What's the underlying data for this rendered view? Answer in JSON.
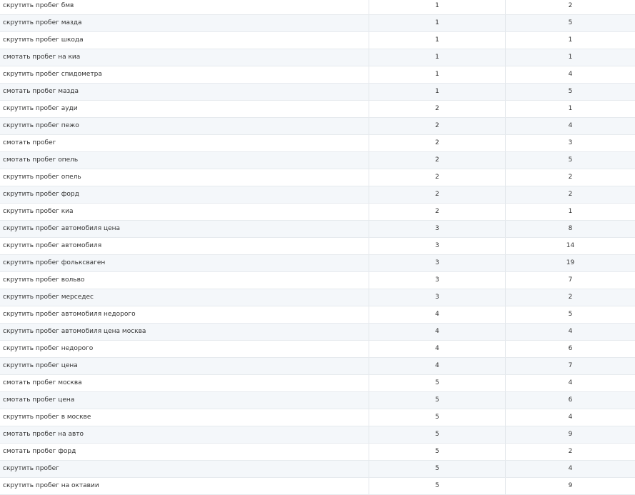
{
  "table": {
    "rows": [
      {
        "query": "скрутить пробег бмв",
        "a": "1",
        "b": "2"
      },
      {
        "query": "скрутить пробег мазда",
        "a": "1",
        "b": "5"
      },
      {
        "query": "скрутить пробег шкода",
        "a": "1",
        "b": "1"
      },
      {
        "query": "смотать пробег на киа",
        "a": "1",
        "b": "1"
      },
      {
        "query": "скрутить пробег спидометра",
        "a": "1",
        "b": "4"
      },
      {
        "query": "смотать пробег мазда",
        "a": "1",
        "b": "5"
      },
      {
        "query": "скрутить пробег ауди",
        "a": "2",
        "b": "1"
      },
      {
        "query": "скрутить пробег пежо",
        "a": "2",
        "b": "4"
      },
      {
        "query": "смотать пробег",
        "a": "2",
        "b": "3"
      },
      {
        "query": "смотать пробег опель",
        "a": "2",
        "b": "5"
      },
      {
        "query": "скрутить пробег опель",
        "a": "2",
        "b": "2"
      },
      {
        "query": "скрутить пробег форд",
        "a": "2",
        "b": "2"
      },
      {
        "query": "скрутить пробег киа",
        "a": "2",
        "b": "1"
      },
      {
        "query": "скрутить пробег автомобиля цена",
        "a": "3",
        "b": "8"
      },
      {
        "query": "скрутить пробег автомобиля",
        "a": "3",
        "b": "14"
      },
      {
        "query": "скрутить пробег фольксваген",
        "a": "3",
        "b": "19"
      },
      {
        "query": "скрутить пробег вольво",
        "a": "3",
        "b": "7"
      },
      {
        "query": "скрутить пробег мерседес",
        "a": "3",
        "b": "2"
      },
      {
        "query": "скрутить пробег автомобиля недорого",
        "a": "4",
        "b": "5"
      },
      {
        "query": "скрутить пробег автомобиля цена москва",
        "a": "4",
        "b": "4"
      },
      {
        "query": "скрутить пробег недорого",
        "a": "4",
        "b": "6"
      },
      {
        "query": "скрутить пробег цена",
        "a": "4",
        "b": "7"
      },
      {
        "query": "смотать пробег москва",
        "a": "5",
        "b": "4"
      },
      {
        "query": "смотать пробег цена",
        "a": "5",
        "b": "6"
      },
      {
        "query": "скрутить пробег в москве",
        "a": "5",
        "b": "4"
      },
      {
        "query": "смотать пробег на авто",
        "a": "5",
        "b": "9"
      },
      {
        "query": "смотать пробег форд",
        "a": "5",
        "b": "2"
      },
      {
        "query": "скрутить пробег",
        "a": "5",
        "b": "4"
      },
      {
        "query": "скрутить пробег на октавии",
        "a": "5",
        "b": "9"
      }
    ]
  }
}
